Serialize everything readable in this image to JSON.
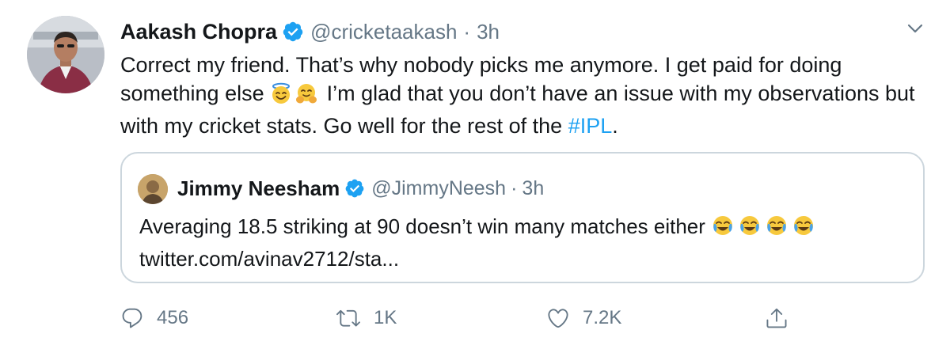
{
  "tweet": {
    "author": {
      "display_name": "Aakash Chopra",
      "handle": "@cricketaakash",
      "dot": "·",
      "time": "3h",
      "verified": true
    },
    "text": {
      "part1": "Correct my friend. That’s why nobody picks me anymore. I get paid for doing something else ",
      "emoji1": "smiling-face-with-halo",
      "emoji2": "hugging-face",
      "part2": " I’m glad that you don’t have an issue with my observations but with my cricket stats. Go well for the rest of the ",
      "hashtag": "#IPL",
      "part3": "."
    },
    "quoted": {
      "author": {
        "display_name": "Jimmy Neesham",
        "handle": "@JimmyNeesh",
        "dot": "·",
        "time": "3h",
        "verified": true
      },
      "text": "Averaging 18.5 striking at 90 doesn’t win many matches either ",
      "emoji": "face-with-tears-of-joy",
      "emoji_count": 4,
      "link": "twitter.com/avinav2712/sta..."
    },
    "actions": {
      "reply_count": "456",
      "retweet_count": "1K",
      "like_count": "7.2K"
    }
  },
  "colors": {
    "text": "#14171a",
    "secondary": "#657786",
    "accent": "#1da1f2",
    "border": "#ccd6dd"
  },
  "icons": {
    "verified": "verified-badge-icon",
    "caret": "chevron-down-icon",
    "reply": "comment-bubble-icon",
    "retweet": "retweet-arrows-icon",
    "like": "heart-icon",
    "share": "share-upload-icon"
  }
}
